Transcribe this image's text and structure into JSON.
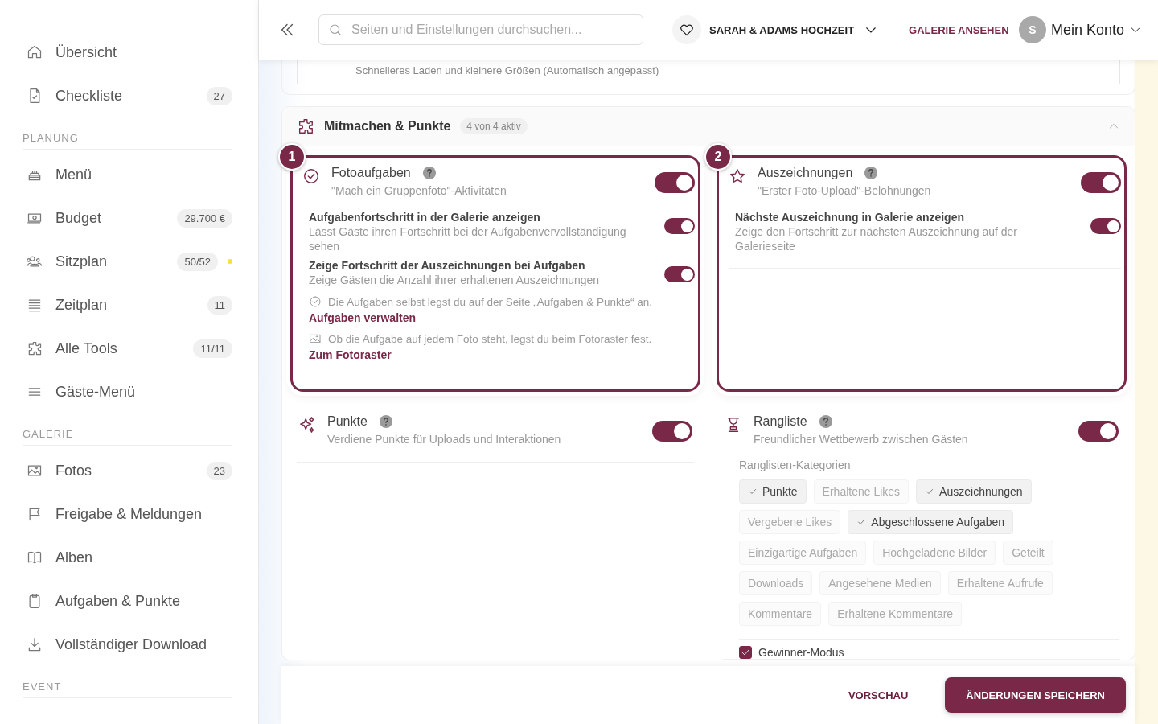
{
  "sidebar": {
    "items": [
      {
        "label": "Übersicht"
      },
      {
        "label": "Checkliste",
        "badge": "27"
      }
    ],
    "sections": [
      {
        "heading": "PLANUNG",
        "items": [
          {
            "label": "Menü"
          },
          {
            "label": "Budget",
            "badge": "29.700 €"
          },
          {
            "label": "Sitzplan",
            "badge": "50/52",
            "color": "#f7e23b"
          },
          {
            "label": "Zeitplan",
            "badge": "11"
          },
          {
            "label": "Alle Tools",
            "badge": "11/11"
          },
          {
            "label": "Gäste-Menü"
          }
        ]
      },
      {
        "heading": "GALERIE",
        "items": [
          {
            "label": "Fotos",
            "badge": "23"
          },
          {
            "label": "Freigabe & Meldungen"
          },
          {
            "label": "Alben"
          },
          {
            "label": "Aufgaben & Punkte"
          },
          {
            "label": "Vollständiger Download"
          }
        ]
      },
      {
        "heading": "EVENT"
      }
    ]
  },
  "header": {
    "search": {
      "placeholder": "Seiten und Einstellungen durchsuchen..."
    },
    "event": "SARAH & ADAMS HOCHZEIT",
    "gallery_link": "GALERIE ANSEHEN",
    "avatar": "S",
    "account": "Mein Konto"
  },
  "top_note": "Schnelleres Laden und kleinere Größen (Automatisch angepasst)",
  "section": {
    "title": "Mitmachen & Punkte",
    "badge": "4 von 4 aktiv",
    "expanded": true,
    "columns": [
      [
        {
          "title": "Fotoaufgaben",
          "description": "\"Mach ein Gruppenfoto\"-Aktivitäten",
          "on": true,
          "step": "1",
          "options": [
            {
              "title": "Aufgabenfortschritt in der Galerie anzeigen",
              "description": "Lässt Gäste ihren Fortschritt bei der Aufgabenvervollständigung sehen",
              "on": true
            },
            {
              "title": "Zeige Fortschritt der Auszeichnungen bei Aufgaben",
              "description": "Zeige Gästen die Anzahl ihrer erhaltenen Auszeichnungen",
              "on": true
            }
          ],
          "notes": [
            {
              "text": "Die Aufgaben selbst legst du auf der Seite „Aufgaben & Punkte“ an.",
              "link": "Aufgaben verwalten"
            },
            {
              "text": "Ob die Aufgabe auf jedem Foto steht, legst du beim Fotoraster fest.",
              "link": "Zum Fotoraster"
            }
          ]
        },
        {
          "title": "Punkte",
          "description": "Verdiene Punkte für Uploads und Interaktionen",
          "on": true
        }
      ],
      [
        {
          "title": "Auszeichnungen",
          "description": "\"Erster Foto-Upload\"-Belohnungen",
          "on": true,
          "step": "2",
          "options": [
            {
              "title": "Nächste Auszeichnung in Galerie anzeigen",
              "description": "Zeige den Fortschritt zur nächsten Auszeichnung auf der Galerieseite",
              "on": true
            }
          ]
        },
        {
          "title": "Rangliste",
          "description": "Freundlicher Wettbewerb zwischen Gästen",
          "on": true,
          "categories_label": "Ranglisten-Kategorien",
          "categories": [
            {
              "label": "Punkte",
              "selected": true
            },
            {
              "label": "Erhaltene Likes",
              "selected": false
            },
            {
              "label": "Auszeichnungen",
              "selected": true
            },
            {
              "label": "Vergebene Likes",
              "selected": false
            },
            {
              "label": "Abgeschlossene Aufgaben",
              "selected": true
            },
            {
              "label": "Einzigartige Aufgaben",
              "selected": false
            },
            {
              "label": "Hochgeladene Bilder",
              "selected": false
            },
            {
              "label": "Geteilt",
              "selected": false
            },
            {
              "label": "Downloads",
              "selected": false
            },
            {
              "label": "Angesehene Medien",
              "selected": false
            },
            {
              "label": "Erhaltene Aufrufe",
              "selected": false
            },
            {
              "label": "Kommentare",
              "selected": false
            },
            {
              "label": "Erhaltene Kommentare",
              "selected": false
            }
          ],
          "checkbox": {
            "label": "Gewinner-Modus",
            "checked": true
          }
        }
      ]
    ]
  },
  "footer": {
    "preview": "VORSCHAU",
    "save": "ÄNDERUNGEN SPEICHERN"
  }
}
